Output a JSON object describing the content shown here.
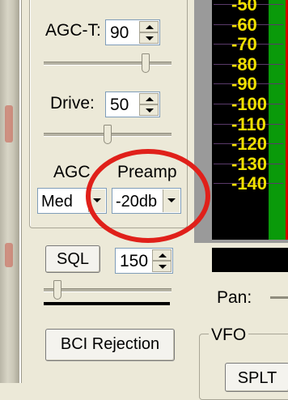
{
  "left_panel": {
    "agc_threshold": {
      "label": "AGC-T:",
      "value": "90"
    },
    "agc_threshold_slider_fraction": 0.82,
    "drive": {
      "label": "Drive:",
      "value": "50"
    },
    "drive_slider_fraction": 0.5,
    "agc": {
      "label": "AGC",
      "value": "Med"
    },
    "preamp": {
      "label": "Preamp",
      "value": "-20db"
    },
    "sql": {
      "button_label": "SQL",
      "value": "150"
    },
    "sql_slider_fraction": 0.08,
    "bci_button_label": "BCI Rejection"
  },
  "meter": {
    "scale_labels": [
      "-50",
      "-60",
      "-70",
      "-80",
      "-90",
      "-100",
      "-110",
      "-120",
      "-130",
      "-140"
    ],
    "colors": {
      "scale_bg": "#000000",
      "labels": "#f0e000",
      "signal_bar": "#0a9a0a",
      "limit_line": "#d00000"
    }
  },
  "right_panel": {
    "pan_label": "Pan:",
    "vfo_title": "VFO",
    "split_button_label": "SPLT"
  },
  "annotation": {
    "color": "#e0201a",
    "shape": "ellipse"
  }
}
